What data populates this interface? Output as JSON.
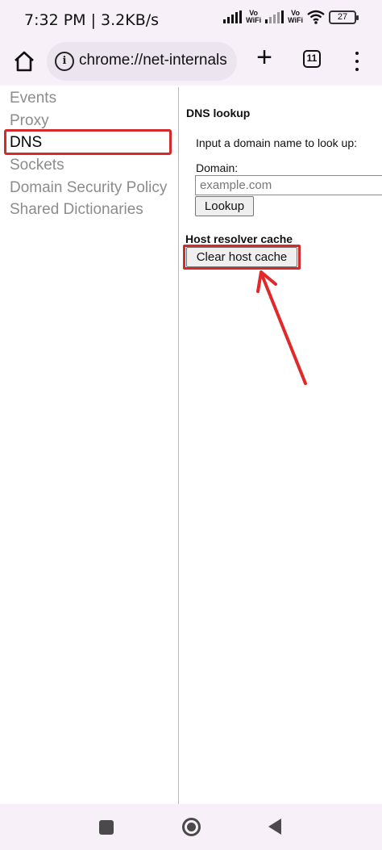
{
  "status_bar": {
    "time": "7:32 PM | 3.2KB/s",
    "vowifi_top": "Vo",
    "vowifi_bottom": "WiFi",
    "battery": "27"
  },
  "toolbar": {
    "url": "chrome://net-internals",
    "tab_count": "11",
    "new_tab_symbol": "+"
  },
  "sidebar": {
    "items": [
      {
        "label": "Events",
        "selected": false
      },
      {
        "label": "Proxy",
        "selected": false
      },
      {
        "label": "DNS",
        "selected": true
      },
      {
        "label": "Sockets",
        "selected": false
      },
      {
        "label": "Domain Security Policy",
        "selected": false
      },
      {
        "label": "Shared Dictionaries",
        "selected": false
      }
    ]
  },
  "dns": {
    "lookup_title": "DNS lookup",
    "instructions": "Input a domain name to look up:",
    "domain_label": "Domain:",
    "domain_placeholder": "example.com",
    "domain_value": "",
    "lookup_button": "Lookup",
    "cache_title": "Host resolver cache",
    "clear_button": "Clear host cache"
  },
  "colors": {
    "highlight": "#d42a2a",
    "chrome_bg": "#f8f0f8",
    "inactive_nav": "#8c8c8c"
  },
  "icons": {
    "home": "home-icon",
    "info": "info-icon",
    "new_tab": "plus-icon",
    "tabs": "tab-switcher-icon",
    "menu": "more-vertical-icon",
    "nav_recent": "recent-apps-icon",
    "nav_home": "home-circle-icon",
    "nav_back": "back-triangle-icon"
  }
}
